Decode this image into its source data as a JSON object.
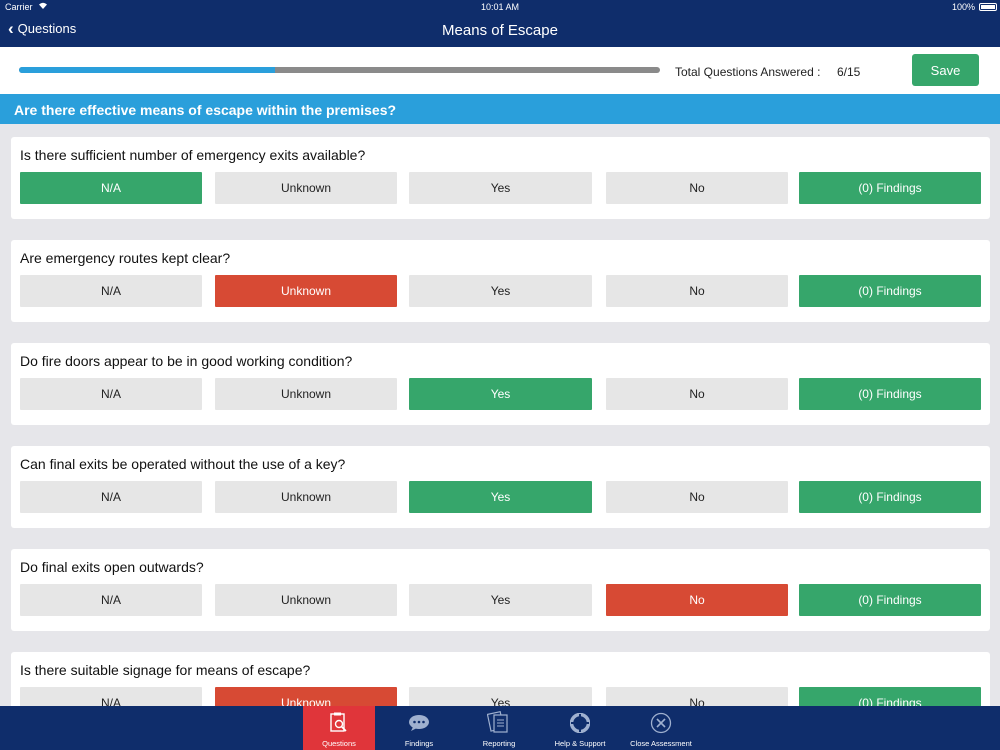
{
  "status_bar": {
    "carrier": "Carrier",
    "time": "10:01 AM",
    "battery": "100%"
  },
  "nav": {
    "back_label": "Questions",
    "title": "Means of Escape"
  },
  "progress": {
    "answered_label": "Total Questions Answered :",
    "answered_count": "6/15",
    "fraction": 0.4,
    "save_label": "Save"
  },
  "section": {
    "title": "Are there effective means of escape within the premises?"
  },
  "options": [
    "N/A",
    "Unknown",
    "Yes",
    "No"
  ],
  "questions": [
    {
      "text": "Is there sufficient number of emergency exits available?",
      "selected": "N/A",
      "findings": "(0) Findings"
    },
    {
      "text": "Are emergency routes kept clear?",
      "selected": "Unknown",
      "findings": "(0) Findings"
    },
    {
      "text": "Do fire doors appear to be in good working condition?",
      "selected": "Yes",
      "findings": "(0) Findings"
    },
    {
      "text": "Can final exits be operated without the use of a key?",
      "selected": "Yes",
      "findings": "(0) Findings"
    },
    {
      "text": "Do final exits open outwards?",
      "selected": "No",
      "findings": "(0) Findings"
    },
    {
      "text": "Is there suitable signage for means of escape?",
      "selected": "Unknown",
      "findings": "(0) Findings"
    }
  ],
  "tabs": [
    {
      "label": "Questions",
      "icon": "questions-icon",
      "active": true
    },
    {
      "label": "Findings",
      "icon": "speech-bubble-icon",
      "active": false
    },
    {
      "label": "Reporting",
      "icon": "documents-icon",
      "active": false
    },
    {
      "label": "Help & Support",
      "icon": "lifebuoy-icon",
      "active": false
    },
    {
      "label": "Close Assessment",
      "icon": "close-circle-icon",
      "active": false
    }
  ],
  "colors": {
    "nav": "#0f2d6b",
    "accent_blue": "#2a9fdb",
    "selected_green": "#36a66b",
    "selected_red": "#d74a34",
    "active_tab": "#e0353a"
  }
}
